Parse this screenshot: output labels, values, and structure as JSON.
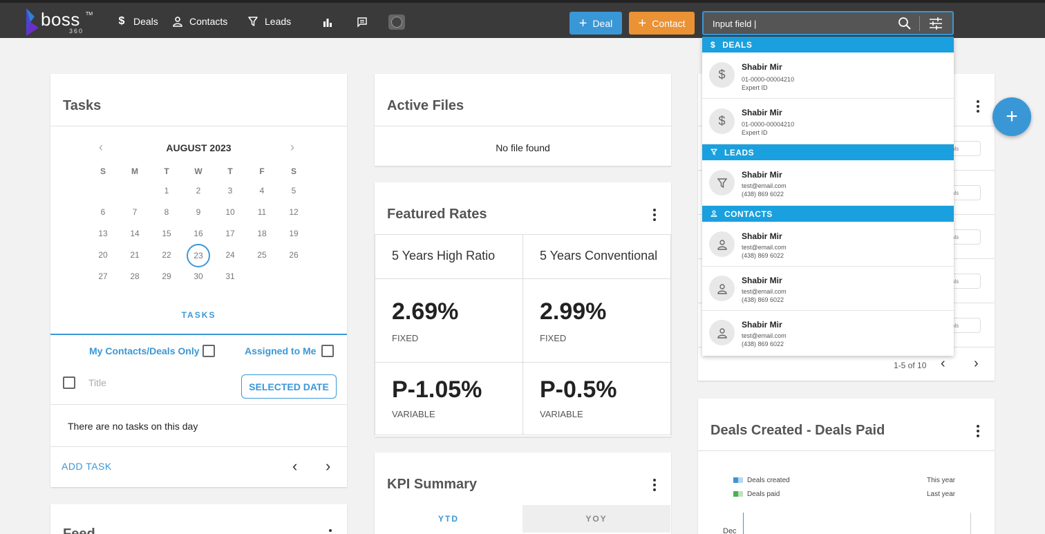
{
  "nav": {
    "logo_text": "boss",
    "logo_tm": "TM",
    "logo_sub": "360",
    "deals_label": "Deals",
    "contacts_label": "Contacts",
    "leads_label": "Leads",
    "add_deal_label": "Deal",
    "add_contact_label": "Contact",
    "search_value": "Input field |"
  },
  "tasks": {
    "title": "Tasks",
    "month": "AUGUST 2023",
    "dow": [
      "S",
      "M",
      "T",
      "W",
      "T",
      "F",
      "S"
    ],
    "weeks": [
      [
        "",
        "",
        "1",
        "2",
        "3",
        "4",
        "5"
      ],
      [
        "6",
        "7",
        "8",
        "9",
        "10",
        "11",
        "12"
      ],
      [
        "13",
        "14",
        "15",
        "16",
        "17",
        "18",
        "19"
      ],
      [
        "20",
        "21",
        "22",
        "23",
        "24",
        "25",
        "26"
      ],
      [
        "27",
        "28",
        "29",
        "30",
        "31",
        "",
        ""
      ]
    ],
    "selected_day": "23",
    "tab_label": "TASKS",
    "filter_my": "My Contacts/Deals Only",
    "filter_assigned": "Assigned to Me",
    "title_column": "Title",
    "selected_date_button": "SELECTED DATE",
    "empty_message": "There are no tasks on this day",
    "add_task": "ADD TASK"
  },
  "feed": {
    "title": "Feed"
  },
  "active_files": {
    "title": "Active Files",
    "empty": "No file found"
  },
  "featured_rates": {
    "title": "Featured Rates",
    "columns": [
      "5 Years High Ratio",
      "5 Years Conventional"
    ],
    "fixed": [
      {
        "value": "2.69%",
        "label": "FIXED"
      },
      {
        "value": "2.99%",
        "label": "FIXED"
      }
    ],
    "variable": [
      {
        "value": "P-1.05%",
        "label": "VARIABLE"
      },
      {
        "value": "P-0.5%",
        "label": "VARIABLE"
      }
    ]
  },
  "kpi": {
    "title": "KPI Summary",
    "tabs": [
      "YTD",
      "YOY"
    ]
  },
  "search_dropdown": {
    "sections": {
      "deals": "DEALS",
      "leads": "LEADS",
      "contacts": "CONTACTS"
    },
    "deals": [
      {
        "name": "Shabir Mir",
        "line1": "01-0000-00004210",
        "line2": "Expert ID"
      },
      {
        "name": "Shabir Mir",
        "line1": "01-0000-00004210",
        "line2": "Expert ID"
      }
    ],
    "leads": [
      {
        "name": "Shabir Mir",
        "line1": "test@email.com",
        "line2": "(438) 869 6022"
      }
    ],
    "contacts": [
      {
        "name": "Shabir Mir",
        "line1": "test@email.com",
        "line2": "(438) 869 6022"
      },
      {
        "name": "Shabir Mir",
        "line1": "test@email.com",
        "line2": "(438) 869 6022"
      },
      {
        "name": "Shabir Mir",
        "line1": "test@email.com",
        "line2": "(438) 869 6022"
      }
    ]
  },
  "right_card": {
    "mini_buttons": [
      "als",
      "als",
      "als",
      "als",
      "als"
    ],
    "pagination": "1-5 of 10"
  },
  "deals_chart": {
    "title": "Deals Created - Deals Paid",
    "legend_created": "Deals created",
    "legend_paid": "Deals paid",
    "this_year": "This year",
    "last_year": "Last year",
    "first_month": "Dec"
  },
  "colors": {
    "accent": "#3a97d6",
    "contact_orange": "#eb9235",
    "section_blue": "#1aa0de",
    "topbar": "#3a3a3a"
  }
}
